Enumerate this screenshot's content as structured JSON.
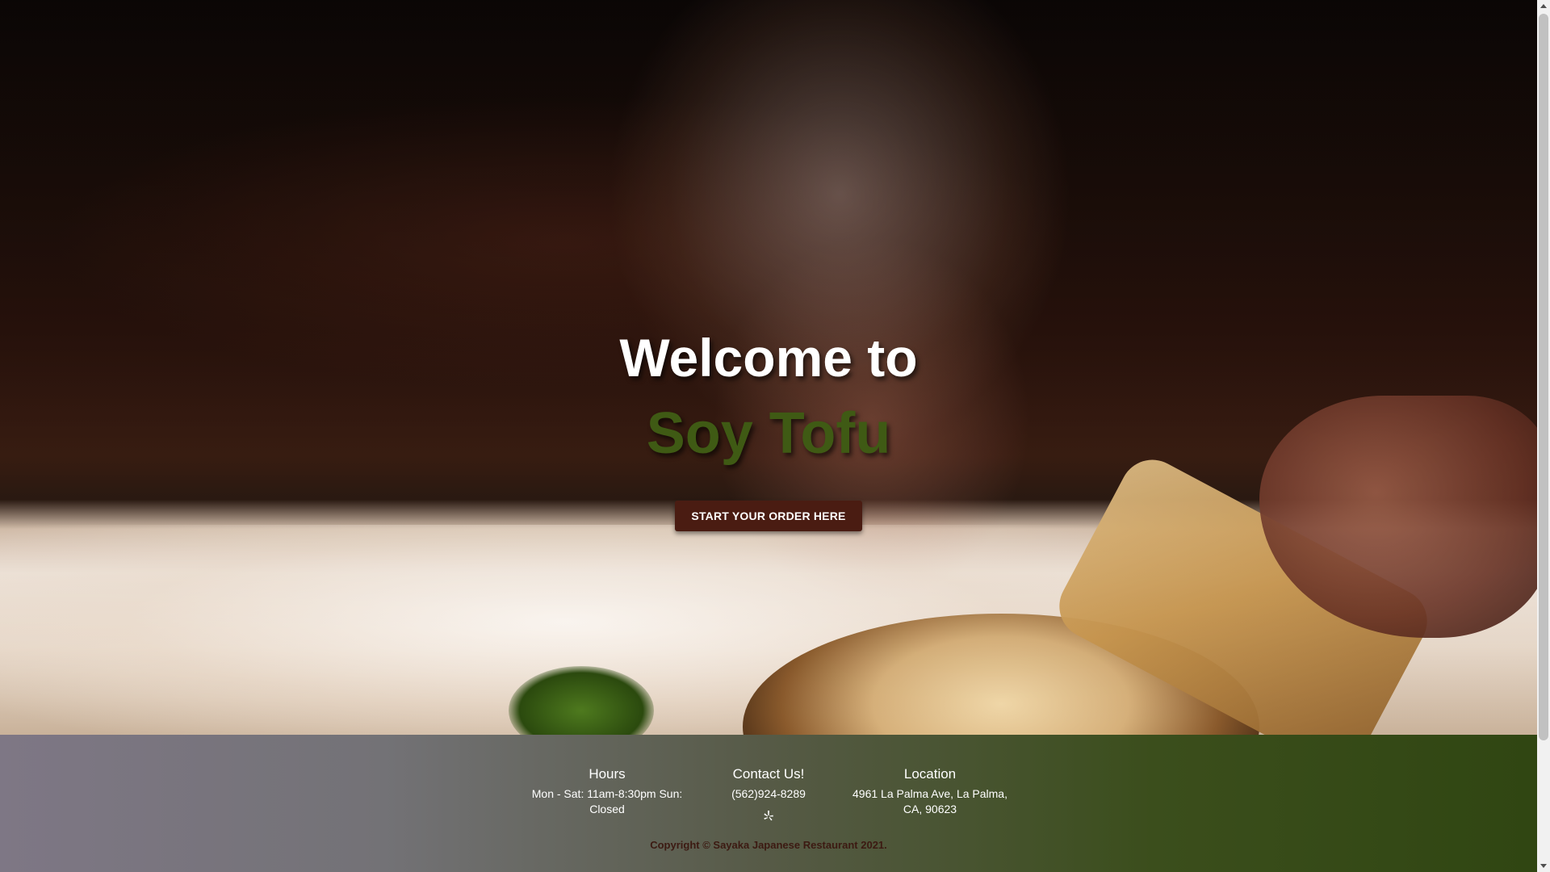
{
  "hero": {
    "welcome": "Welcome to",
    "brand": "Soy Tofu",
    "order_button": "START YOUR ORDER HERE"
  },
  "footer": {
    "hours": {
      "heading": "Hours",
      "text": "Mon - Sat: 11am-8:30pm Sun: Closed"
    },
    "contact": {
      "heading": "Contact Us!",
      "phone": "(562)924-8289",
      "icon": "yelp-icon"
    },
    "location": {
      "heading": "Location",
      "address": "4961 La Palma Ave, La Palma, CA, 90623"
    },
    "copyright": "Copyright © Sayaka Japanese Restaurant 2021."
  },
  "colors": {
    "brand_green": "#3f5a14",
    "button_bg": "#4a1c12",
    "copyright_text": "#3c1a12"
  }
}
